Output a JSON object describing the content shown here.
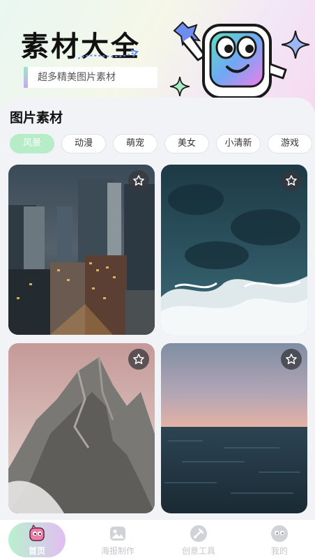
{
  "header": {
    "title": "素材大全",
    "subtitle": "超多精美图片素材"
  },
  "section": {
    "title": "图片素材"
  },
  "tabs": [
    {
      "label": "风景",
      "active": true
    },
    {
      "label": "动漫",
      "active": false
    },
    {
      "label": "萌宠",
      "active": false
    },
    {
      "label": "美女",
      "active": false
    },
    {
      "label": "小清新",
      "active": false
    },
    {
      "label": "游戏",
      "active": false
    }
  ],
  "cards": [
    {
      "subject": "city-skyline-night",
      "favorite_icon": "star-outline-icon"
    },
    {
      "subject": "ocean-waves-aerial",
      "favorite_icon": "star-outline-icon"
    },
    {
      "subject": "rocky-mountain-peak",
      "favorite_icon": "star-outline-icon"
    },
    {
      "subject": "sea-horizon-dusk",
      "favorite_icon": "star-outline-icon"
    }
  ],
  "bottom_nav": {
    "items": [
      {
        "label": "首页",
        "icon": "home-mascot-icon",
        "active": true
      },
      {
        "label": "海报制作",
        "icon": "image-icon",
        "active": false
      },
      {
        "label": "创意工具",
        "icon": "brush-tool-icon",
        "active": false
      },
      {
        "label": "我的",
        "icon": "profile-icon",
        "active": false
      }
    ]
  },
  "colors": {
    "accent_green": "#b7ecc9",
    "accent_purple": "#e2bdf2",
    "inactive_nav": "#c3c6cb"
  }
}
